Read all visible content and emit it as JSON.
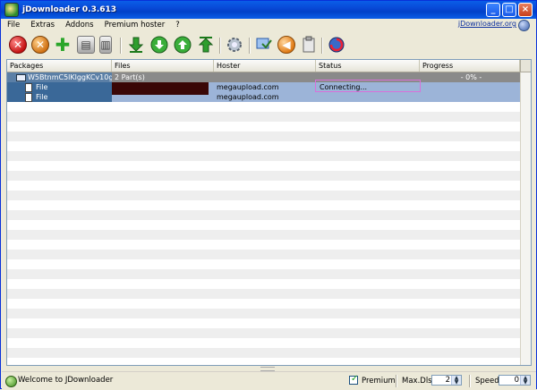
{
  "window": {
    "title": "jDownloader 0.3.613",
    "controls": [
      "_",
      "□",
      "×"
    ]
  },
  "menu": {
    "items": [
      "File",
      "Extras",
      "Addons",
      "Premium hoster",
      "?"
    ],
    "site_link": "jDownloader.org"
  },
  "toolbar": {
    "icons": [
      "stop-icon",
      "cancel-icon",
      "add-icon",
      "links-icon",
      "trash-icon",
      "move-bottom-icon",
      "move-down-icon",
      "move-up-icon",
      "move-top-icon",
      "settings-icon",
      "reconnect-icon",
      "clipboard-toggle-icon",
      "clipboard-icon",
      "update-icon"
    ]
  },
  "table": {
    "columns": [
      "Packages",
      "Files",
      "Hoster",
      "Status",
      "Progress"
    ],
    "package": {
      "name": "W5BtnmC5lKlggKCv10gi",
      "files": "2 Part(s)",
      "progress": "- 0% -"
    },
    "files": [
      {
        "name": "File",
        "hoster": "megaupload.com",
        "status": "Connecting..."
      },
      {
        "name": "File",
        "hoster": "megaupload.com",
        "status": ""
      }
    ]
  },
  "statusbar": {
    "message": "Welcome to JDownloader",
    "premium_label": "Premium",
    "premium_checked": true,
    "maxdls_label": "Max.Dls.",
    "maxdls_value": "2",
    "speed_label": "Speed",
    "speed_value": "0"
  }
}
